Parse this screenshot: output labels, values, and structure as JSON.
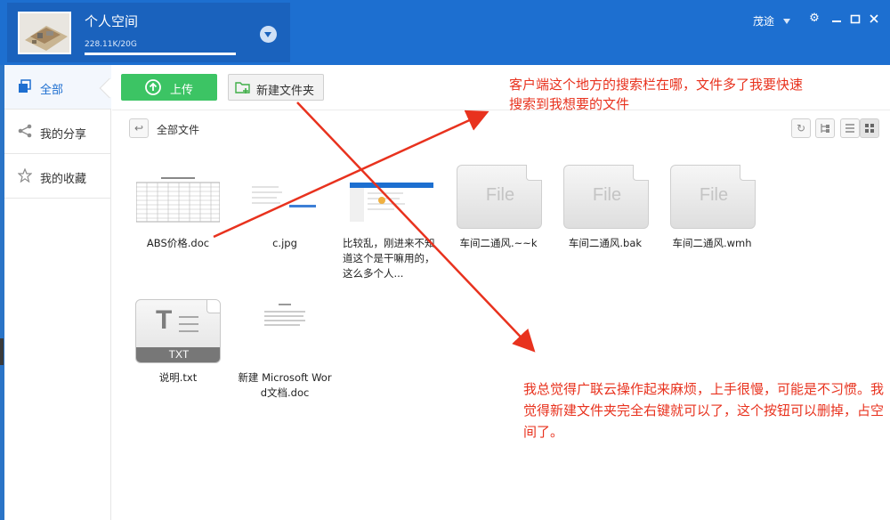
{
  "header": {
    "space_title": "个人空间",
    "quota": "228.11K/20G",
    "username": "茂途"
  },
  "sidebar": {
    "items": [
      {
        "label": "全部",
        "icon": "layers-icon"
      },
      {
        "label": "我的分享",
        "icon": "share-icon"
      },
      {
        "label": "我的收藏",
        "icon": "star-icon"
      }
    ]
  },
  "toolbar": {
    "upload_label": "上传",
    "new_folder_label": "新建文件夹"
  },
  "breadcrumb": {
    "label": "全部文件"
  },
  "files": [
    {
      "name": "ABS价格.doc",
      "type": "doc-preview"
    },
    {
      "name": "c.jpg",
      "type": "image-preview"
    },
    {
      "name": "比较乱，刚进来不知道这个是干嘛用的，这么多个人...",
      "type": "image-preview"
    },
    {
      "name": "车间二通风.~~k",
      "type": "generic",
      "icon_text": "File"
    },
    {
      "name": "车间二通风.bak",
      "type": "generic",
      "icon_text": "File"
    },
    {
      "name": "车间二通风.wmh",
      "type": "generic",
      "icon_text": "File"
    },
    {
      "name": "说明.txt",
      "type": "txt",
      "icon_text": "TXT"
    },
    {
      "name": "新建 Microsoft Word文档.doc",
      "type": "doc-preview"
    }
  ],
  "annotations": {
    "note1": "客户端这个地方的搜索栏在哪，文件多了我要快速搜索到我想要的文件",
    "note2": "我总觉得广联云操作起来麻烦，上手很慢，可能是不习惯。我觉得新建文件夹完全右键就可以了，这个按钮可以删掉，占空间了。"
  },
  "colors": {
    "header": "#1d6fd0",
    "upload": "#3cc464",
    "annotation": "#e8321e"
  }
}
